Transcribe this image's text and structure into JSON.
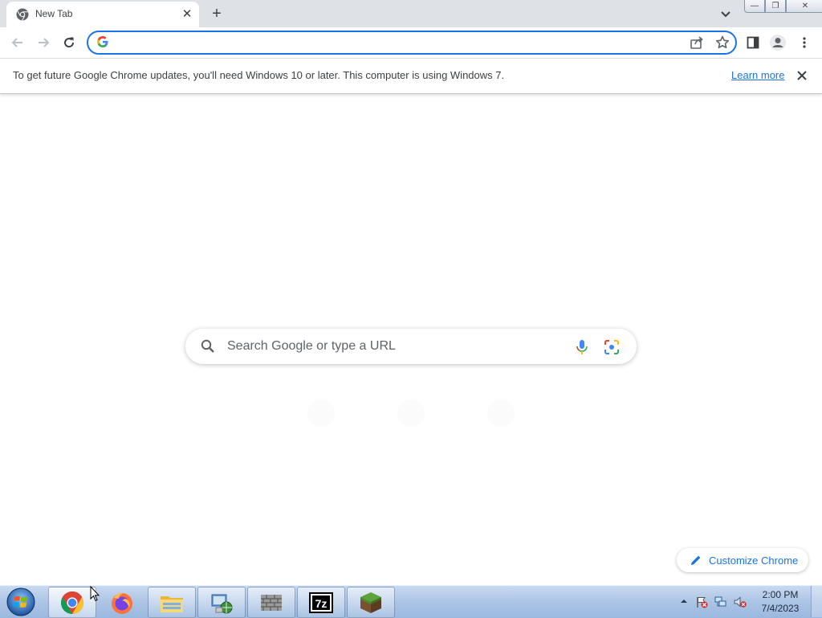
{
  "browser": {
    "tab": {
      "title": "New Tab",
      "close_glyph": "✕"
    },
    "new_tab_glyph": "+",
    "omnibox": {
      "value": "",
      "placeholder": ""
    },
    "window_controls": {
      "minimize": "—",
      "restore": "❐",
      "close": "✕"
    }
  },
  "infobar": {
    "message": "To get future Google Chrome updates, you'll need Windows 10 or later. This computer is using Windows 7.",
    "link": "Learn more"
  },
  "ntp": {
    "search_placeholder": "Search Google or type a URL",
    "customize_label": "Customize Chrome"
  },
  "taskbar": {
    "items": [
      {
        "name": "chrome-icon",
        "active": true
      },
      {
        "name": "firefox-icon",
        "active": false
      },
      {
        "name": "file-explorer-icon",
        "active": false
      },
      {
        "name": "network-settings-icon",
        "active": false
      },
      {
        "name": "firewall-icon",
        "active": false
      },
      {
        "name": "7zip-icon",
        "active": false
      },
      {
        "name": "minecraft-icon",
        "active": false
      }
    ],
    "clock": {
      "time": "2:00 PM",
      "date": "7/4/2023"
    }
  },
  "colors": {
    "accent": "#1a73e8",
    "tabstrip": "#dee1e6",
    "taskbar": "#aec6e6"
  }
}
